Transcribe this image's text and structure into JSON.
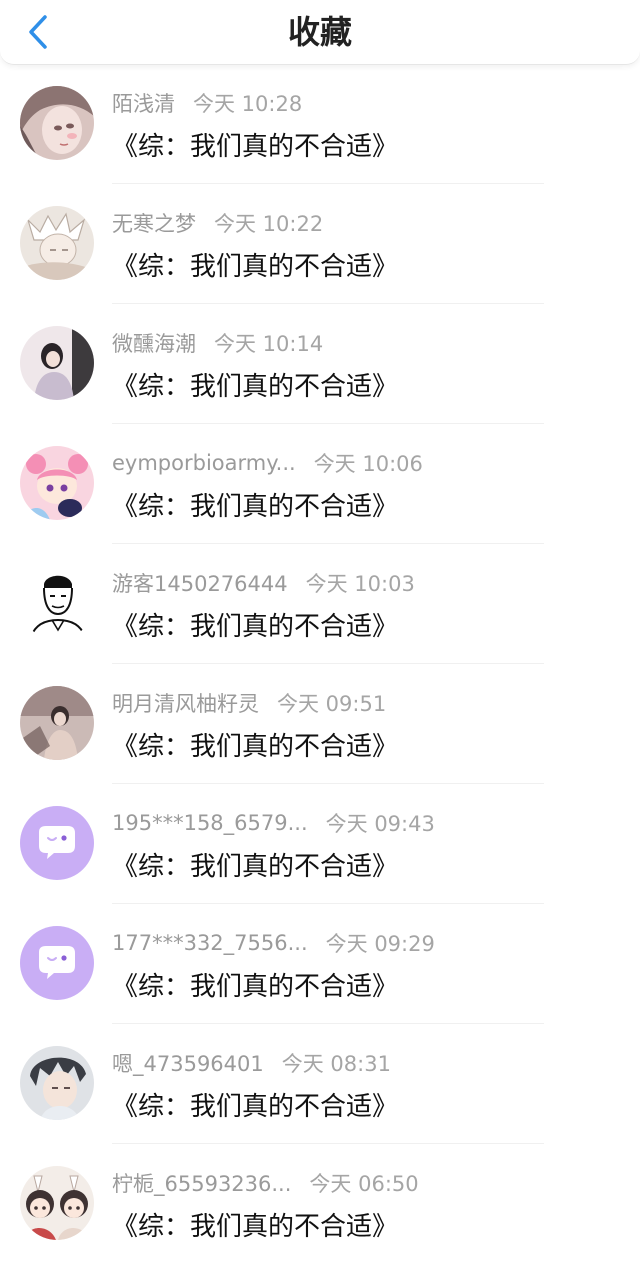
{
  "header": {
    "title": "收藏"
  },
  "colors": {
    "accent": "#2f8fe8",
    "purple_avatar": "#c9aef5"
  },
  "items": [
    {
      "name": "陌浅清",
      "time": "今天 10:28",
      "content": "《综：我们真的不合适》",
      "avatar": "anime-girl-pink"
    },
    {
      "name": "无寒之梦",
      "time": "今天 10:22",
      "content": "《综：我们真的不合适》",
      "avatar": "sketch-boy"
    },
    {
      "name": "微醺海潮",
      "time": "今天 10:14",
      "content": "《综：我们真的不合适》",
      "avatar": "photo-girl"
    },
    {
      "name": "eymporbioarmy...",
      "time": "今天 10:06",
      "content": "《综：我们真的不合适》",
      "avatar": "sailor-chibi"
    },
    {
      "name": "游客1450276444",
      "time": "今天 10:03",
      "content": "《综：我们真的不合适》",
      "avatar": "sketch-man"
    },
    {
      "name": "明月清风柚籽灵",
      "time": "今天 09:51",
      "content": "《综：我们真的不合适》",
      "avatar": "painted-figure"
    },
    {
      "name": "195***158_6579...",
      "time": "今天 09:43",
      "content": "《综：我们真的不合适》",
      "avatar": "chat-bubble-default"
    },
    {
      "name": "177***332_7556...",
      "time": "今天 09:29",
      "content": "《综：我们真的不合适》",
      "avatar": "chat-bubble-default"
    },
    {
      "name": "嗯_473596401",
      "time": "今天 08:31",
      "content": "《综：我们真的不合适》",
      "avatar": "anime-boy"
    },
    {
      "name": "柠栀_65593236...",
      "time": "今天 06:50",
      "content": "《综：我们真的不合适》",
      "avatar": "chibi-pair"
    }
  ]
}
